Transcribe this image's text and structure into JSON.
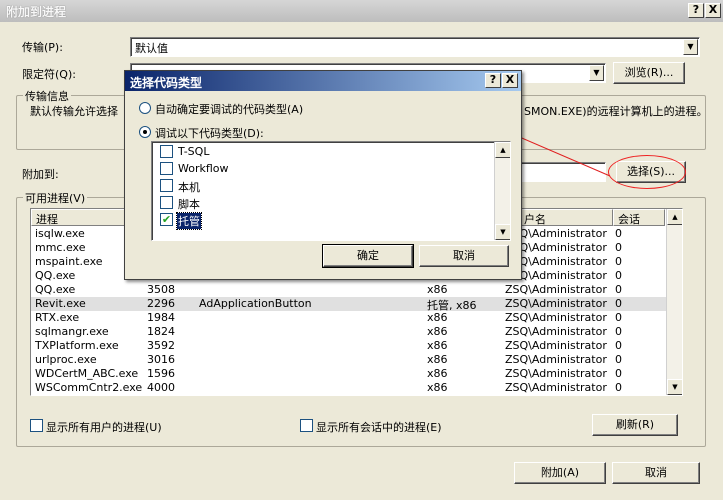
{
  "window": {
    "title": "附加到进程",
    "help_btn": "?",
    "close_btn": "X"
  },
  "transport": {
    "label": "传输(P):",
    "value": "默认值"
  },
  "qualifier": {
    "label": "限定符(Q):",
    "value": "",
    "browse": "浏览(R)..."
  },
  "transport_info": {
    "title": "传输信息",
    "text_left": "默认传输允许选择",
    "text_right": "SMON.EXE)的远程计算机上的进程。"
  },
  "attach_to": {
    "label": "附加到:",
    "select": "选择(S)..."
  },
  "available": {
    "title": "可用进程(V)",
    "columns": [
      "进程",
      "",
      "",
      "",
      "户名",
      "会话"
    ],
    "rows": [
      {
        "name": "isqlw.exe",
        "id": "",
        "title": "",
        "type": "",
        "user": "ZSQ\\Administrator",
        "session": "0"
      },
      {
        "name": "mmc.exe",
        "id": "",
        "title": "",
        "type": "",
        "user": "ZSQ\\Administrator",
        "session": "0"
      },
      {
        "name": "mspaint.exe",
        "id": "",
        "title": "",
        "type": "",
        "user": "ZSQ\\Administrator",
        "session": "0"
      },
      {
        "name": "QQ.exe",
        "id": "",
        "title": "",
        "type": "",
        "user": "ZSQ\\Administrator",
        "session": "0"
      },
      {
        "name": "QQ.exe",
        "id": "3508",
        "title": "",
        "type": "x86",
        "user": "ZSQ\\Administrator",
        "session": "0"
      },
      {
        "name": "Revit.exe",
        "id": "2296",
        "title": "AdApplicationButton",
        "type": "托管, x86",
        "user": "ZSQ\\Administrator",
        "session": "0"
      },
      {
        "name": "RTX.exe",
        "id": "1984",
        "title": "",
        "type": "x86",
        "user": "ZSQ\\Administrator",
        "session": "0"
      },
      {
        "name": "sqlmangr.exe",
        "id": "1824",
        "title": "",
        "type": "x86",
        "user": "ZSQ\\Administrator",
        "session": "0"
      },
      {
        "name": "TXPlatform.exe",
        "id": "3592",
        "title": "",
        "type": "x86",
        "user": "ZSQ\\Administrator",
        "session": "0"
      },
      {
        "name": "urlproc.exe",
        "id": "3016",
        "title": "",
        "type": "x86",
        "user": "ZSQ\\Administrator",
        "session": "0"
      },
      {
        "name": "WDCertM_ABC.exe",
        "id": "1596",
        "title": "",
        "type": "x86",
        "user": "ZSQ\\Administrator",
        "session": "0"
      },
      {
        "name": "WSCommCntr2.exe",
        "id": "4000",
        "title": "",
        "type": "x86",
        "user": "ZSQ\\Administrator",
        "session": "0"
      }
    ]
  },
  "options": {
    "all_users": "显示所有用户的进程(U)",
    "all_sessions": "显示所有会话中的进程(E)",
    "refresh": "刷新(R)"
  },
  "footer": {
    "attach": "附加(A)",
    "cancel": "取消"
  },
  "dialog": {
    "title": "选择代码类型",
    "help_btn": "?",
    "close_btn": "X",
    "auto": "自动确定要调试的代码类型(A)",
    "manual": "调试以下代码类型(D):",
    "types": [
      {
        "label": "T-SQL",
        "checked": false
      },
      {
        "label": "Workflow",
        "checked": false
      },
      {
        "label": "本机",
        "checked": false
      },
      {
        "label": "脚本",
        "checked": false
      },
      {
        "label": "托管",
        "checked": true
      }
    ],
    "ok": "确定",
    "cancel": "取消"
  },
  "colors": {
    "annotation": "#e02020",
    "dialog_title": "#0a246a"
  }
}
